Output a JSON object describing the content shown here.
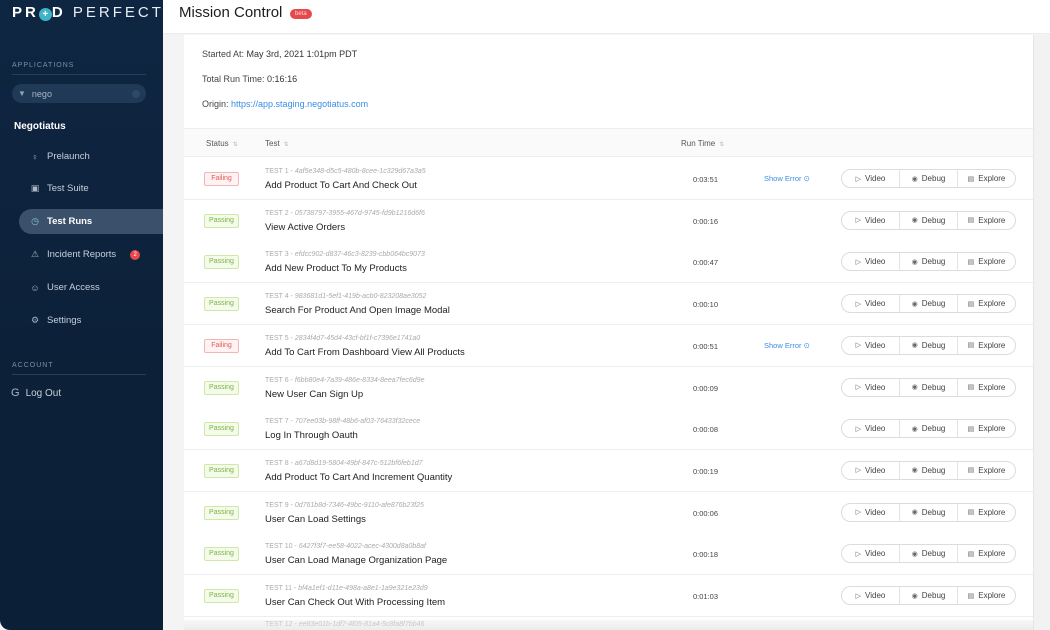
{
  "sidebar": {
    "logo": {
      "part1": "PR",
      "o": "+",
      "part2": "D",
      "part3": "PERFECT"
    },
    "applications_label": "APPLICATIONS",
    "app_search": {
      "value": "nego",
      "filter_icon": "filter-icon"
    },
    "app_name": "Negotiatus",
    "items": [
      {
        "label": "Prelaunch",
        "icon": "microphone-icon",
        "glyph": "♀",
        "active": false
      },
      {
        "label": "Test Suite",
        "icon": "test-suite-icon",
        "glyph": "▣",
        "active": false
      },
      {
        "label": "Test Runs",
        "icon": "clock-icon",
        "glyph": "◷",
        "active": true
      },
      {
        "label": "Incident Reports",
        "icon": "warning-icon",
        "glyph": "⚠",
        "active": false,
        "badge": "2"
      },
      {
        "label": "User Access",
        "icon": "users-icon",
        "glyph": "☺",
        "active": false
      },
      {
        "label": "Settings",
        "icon": "gear-icon",
        "glyph": "⚙",
        "active": false
      }
    ],
    "account_label": "ACCOUNT",
    "logout_label": "Log Out",
    "logout_glyph": "G"
  },
  "header": {
    "title": "Mission Control",
    "badge": "beta"
  },
  "run": {
    "started_label": "Started At:",
    "started_value": "May 3rd, 2021 1:01pm PDT",
    "total_label": "Total Run Time:",
    "total_value": "0:16:16",
    "origin_label": "Origin:",
    "origin_value": "https://app.staging.negotiatus.com"
  },
  "table": {
    "columns": {
      "status": "Status",
      "test": "Test",
      "run_time": "Run Time"
    },
    "sort_glyph": "⇅",
    "button_labels": {
      "video": "Video",
      "debug": "Debug",
      "explore": "Explore"
    },
    "show_error_label": "Show Error",
    "show_error_glyph": "⊙",
    "rows": [
      {
        "status": "Failing",
        "id": "TEST 1",
        "uuid": "4af5e348-d5c5-480b-8cee-1c329d67a3a5",
        "name": "Add Product To Cart And Check Out",
        "run_time": "0:03:51",
        "error": true
      },
      {
        "status": "Passing",
        "id": "TEST 2",
        "uuid": "05738797-3955-467d-9745-fd9b1216d6f6",
        "name": "View Active Orders",
        "run_time": "0:00:16",
        "error": false
      },
      {
        "status": "Passing",
        "id": "TEST 3",
        "uuid": "efdcc902-d837-46c3-8239-cbb064bc9073",
        "name": "Add New Product To My Products",
        "run_time": "0:00:47",
        "error": false
      },
      {
        "status": "Passing",
        "id": "TEST 4",
        "uuid": "983681d1-5ef1-419b-acb0-823208ae3052",
        "name": "Search For Product And Open Image Modal",
        "run_time": "0:00:10",
        "error": false
      },
      {
        "status": "Failing",
        "id": "TEST 5",
        "uuid": "2834f4d7-45d4-43cf-bf1f-c7396e1741a0",
        "name": "Add To Cart From Dashboard View All Products",
        "run_time": "0:00:51",
        "error": true
      },
      {
        "status": "Passing",
        "id": "TEST 6",
        "uuid": "f6bb80e4-7a39-486e-8334-8eea7fec6d9e",
        "name": "New User Can Sign Up",
        "run_time": "0:00:09",
        "error": false
      },
      {
        "status": "Passing",
        "id": "TEST 7",
        "uuid": "707ee03b-98ff-48b6-af03-76433f32cece",
        "name": "Log In Through Oauth",
        "run_time": "0:00:08",
        "error": false
      },
      {
        "status": "Passing",
        "id": "TEST 8",
        "uuid": "a67d8d19-5804-49bf-847c-512bf6feb1d7",
        "name": "Add Product To Cart And Increment Quantity",
        "run_time": "0:00:19",
        "error": false
      },
      {
        "status": "Passing",
        "id": "TEST 9",
        "uuid": "0d761b8d-7346-49bc-9110-afe876b23f25",
        "name": "User Can Load Settings",
        "run_time": "0:00:06",
        "error": false
      },
      {
        "status": "Passing",
        "id": "TEST 10",
        "uuid": "6427f3f7-ee58-4022-acec-4300d8a0b8af",
        "name": "User Can Load Manage Organization Page",
        "run_time": "0:00:18",
        "error": false
      },
      {
        "status": "Passing",
        "id": "TEST 11",
        "uuid": "bf4a1ef1-d11e-498a-a8e1-1a9e321e23d9",
        "name": "User Can Check Out With Processing Item",
        "run_time": "0:01:03",
        "error": false
      }
    ],
    "partial_row": {
      "id": "TEST 12",
      "uuid": "ee83e01b-1df7-4f05-81a4-5c8fa8f7bb46"
    }
  }
}
